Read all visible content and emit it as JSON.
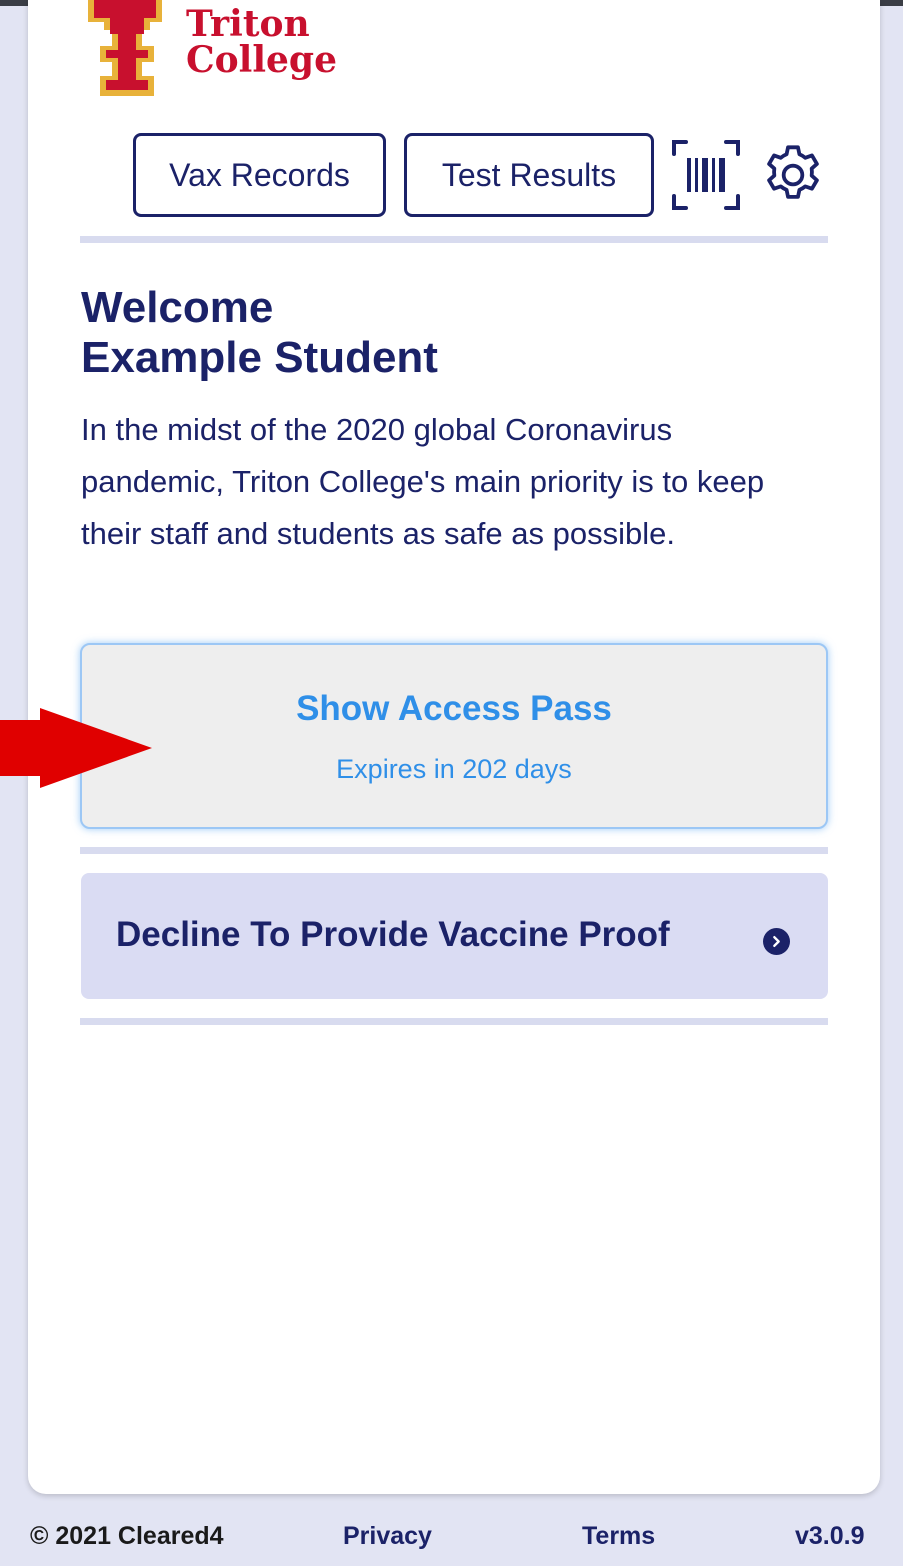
{
  "brand": {
    "logo_line1": "Triton",
    "logo_line2": "College",
    "logo_color": "#c8102e",
    "logo_gold": "#e8b23a"
  },
  "nav": {
    "vax_records_label": "Vax Records",
    "test_results_label": "Test Results",
    "icons": [
      "barcode-scan-icon",
      "gear-icon"
    ]
  },
  "welcome": {
    "line1": "Welcome",
    "line2": "Example Student",
    "intro": "In the midst of the 2020 global Coronavirus pandemic, Triton College's main priority is to keep their staff and students as safe as possible."
  },
  "access_pass": {
    "title": "Show Access Pass",
    "subtitle": "Expires in 202 days",
    "accent_color": "#2f8fe8"
  },
  "decline": {
    "label": "Decline To Provide Vaccine Proof",
    "icon": "chevron-right-circle-icon"
  },
  "annotation": {
    "icon": "red-arrow-icon",
    "color": "#e00000"
  },
  "footer": {
    "copyright": "© 2021 Cleared4",
    "privacy": "Privacy",
    "terms": "Terms",
    "version": "v3.0.9"
  },
  "colors": {
    "primary": "#1b2268",
    "background": "#e2e4f3",
    "card": "#ffffff"
  }
}
